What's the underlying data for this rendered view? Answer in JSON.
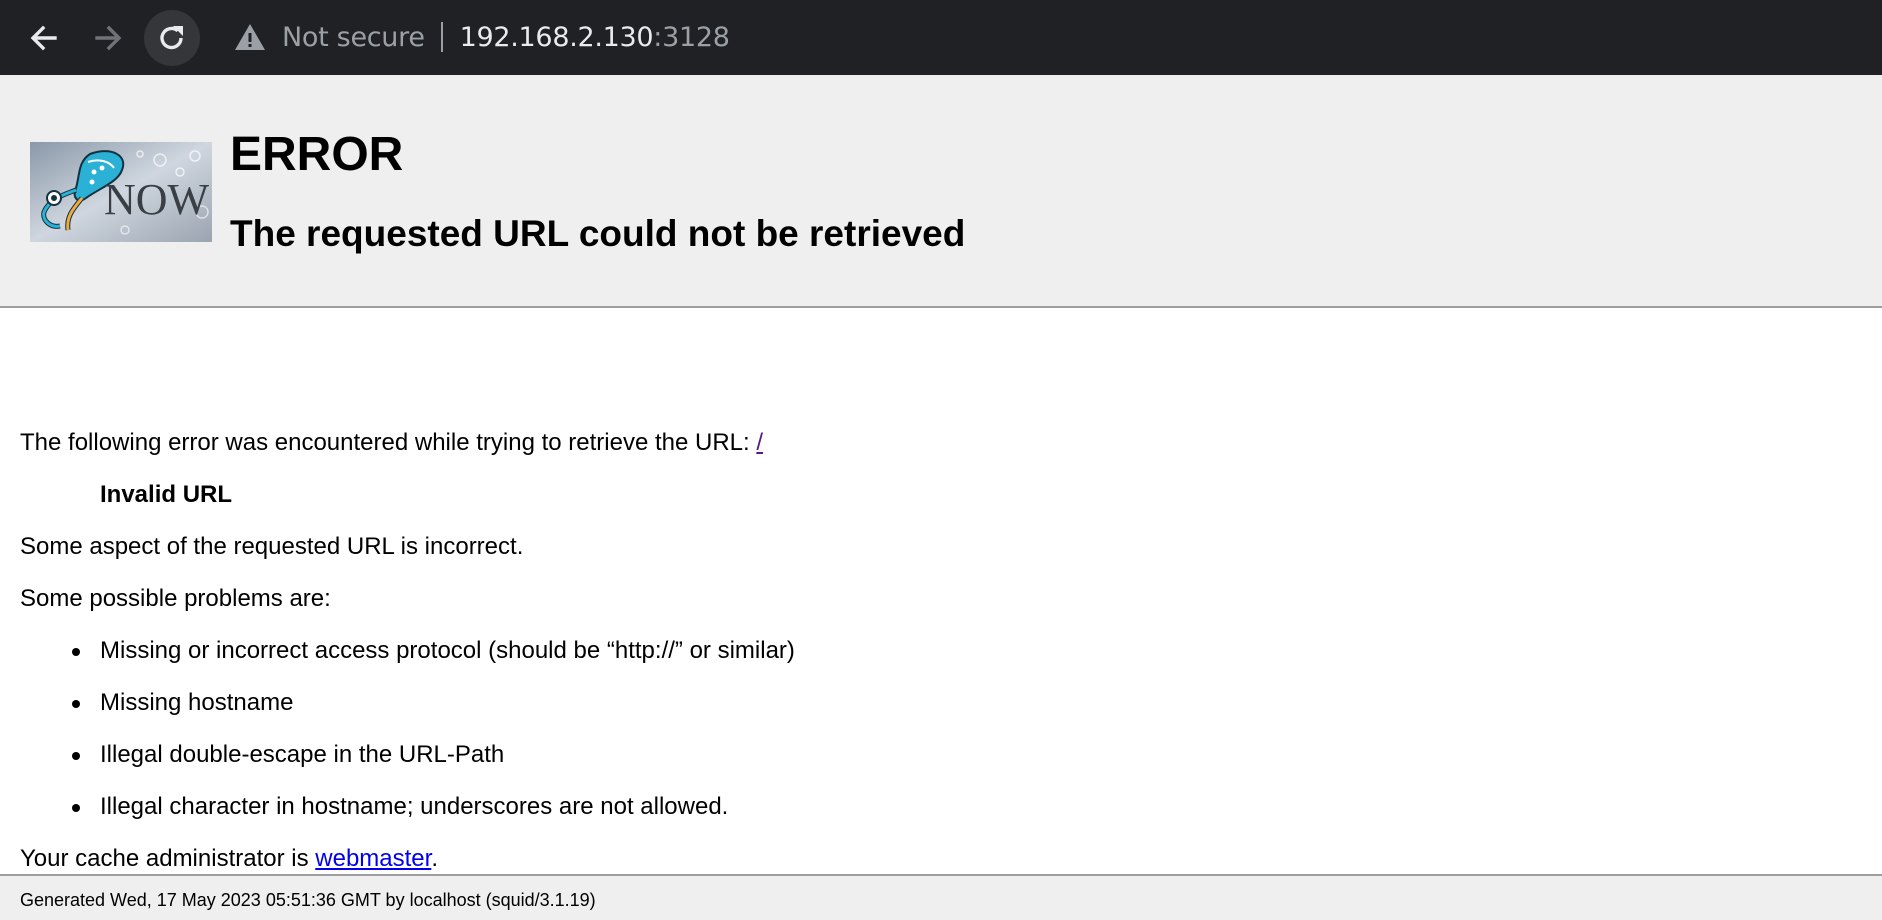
{
  "browser": {
    "security_label": "Not secure",
    "url_host": "192.168.2.130",
    "url_port": ":3128",
    "icons": {
      "back": "arrow-left-icon",
      "forward": "arrow-right-icon",
      "reload": "reload-icon",
      "security": "warning-triangle-icon"
    }
  },
  "page": {
    "logo_alt": "NOW",
    "title": "ERROR",
    "subtitle": "The requested URL could not be retrieved",
    "intro_text": "The following error was encountered while trying to retrieve the URL: ",
    "intro_link": "/",
    "error_name": "Invalid URL",
    "error_description": "Some aspect of the requested URL is incorrect.",
    "problems_heading": "Some possible problems are:",
    "problems": [
      "Missing or incorrect access protocol (should be “http://” or similar)",
      "Missing hostname",
      "Illegal double-escape in the URL-Path",
      "Illegal character in hostname; underscores are not allowed."
    ],
    "admin_prefix": "Your cache administrator is ",
    "admin_link": "webmaster",
    "admin_suffix": ".",
    "footer": "Generated Wed, 17 May 2023 05:51:36 GMT by localhost (squid/3.1.19)"
  },
  "colors": {
    "chrome_bg": "#202124",
    "header_bg": "#efefef",
    "link": "#0000ee",
    "visited_link": "#551a8b"
  }
}
